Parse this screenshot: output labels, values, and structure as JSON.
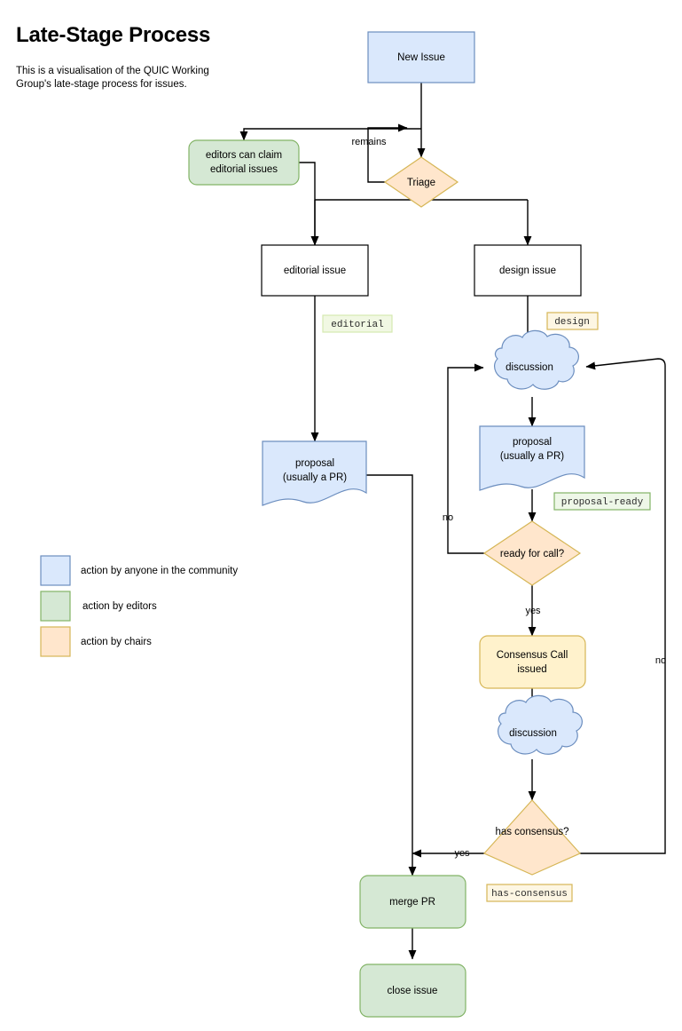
{
  "header": {
    "title": "Late-Stage Process",
    "description": "This is a visualisation of the QUIC Working Group's late-stage process for issues."
  },
  "colors": {
    "community_fill": "#dae8fc",
    "community_stroke": "#6c8ebf",
    "editors_fill": "#d5e8d4",
    "editors_stroke": "#82b366",
    "chairs_fill": "#ffe6cc",
    "chairs_stroke": "#d6b656",
    "chairs_fill_light": "#fff2cc",
    "plain_fill": "#ffffff",
    "plain_stroke": "#000000",
    "edge_stroke": "#000000",
    "tag_editorial_fill": "#f1f8e3",
    "tag_editorial_stroke": "#d6e9b0",
    "tag_design_fill": "#fdf6e3",
    "tag_design_stroke": "#d6b656",
    "tag_ready_fill": "#eef7e8",
    "tag_ready_stroke": "#82b366",
    "tag_consensus_fill": "#fdf6e3",
    "tag_consensus_stroke": "#d6b656"
  },
  "nodes": {
    "new_issue": {
      "label": "New Issue",
      "actor": "community"
    },
    "editors_claim": {
      "label_line1": "editors can claim",
      "label_line2": "editorial issues",
      "actor": "editors"
    },
    "triage": {
      "label": "Triage",
      "actor": "chairs"
    },
    "editorial_issue": {
      "label": "editorial issue",
      "actor": "plain"
    },
    "design_issue": {
      "label": "design issue",
      "actor": "plain"
    },
    "discussion_top": {
      "label": "discussion",
      "actor": "community"
    },
    "proposal_right": {
      "label_line1": "proposal",
      "label_line2": "(usually a PR)",
      "actor": "community"
    },
    "proposal_left": {
      "label_line1": "proposal",
      "label_line2": "(usually a PR)",
      "actor": "community"
    },
    "ready_for_call": {
      "label": "ready for call?",
      "actor": "chairs"
    },
    "consensus_call": {
      "label_line1": "Consensus Call",
      "label_line2": "issued",
      "actor": "chairs"
    },
    "discussion_bottom": {
      "label": "discussion",
      "actor": "community"
    },
    "has_consensus": {
      "label": "has consensus?",
      "actor": "chairs"
    },
    "merge_pr": {
      "label": "merge PR",
      "actor": "editors"
    },
    "close_issue": {
      "label": "close issue",
      "actor": "editors"
    }
  },
  "tags": [
    {
      "id": "editorial",
      "text": "editorial"
    },
    {
      "id": "design",
      "text": "design"
    },
    {
      "id": "proposal-ready",
      "text": "proposal-ready"
    },
    {
      "id": "has-consensus",
      "text": "has-consensus"
    }
  ],
  "edge_labels": {
    "remains": "remains",
    "no_ready": "no",
    "yes_ready": "yes",
    "no_consensus": "no",
    "yes_consensus": "yes"
  },
  "legend": {
    "items": [
      {
        "swatch": "community",
        "label": "action by anyone in the community"
      },
      {
        "swatch": "editors",
        "label": "action by editors"
      },
      {
        "swatch": "chairs",
        "label": "action by chairs"
      }
    ]
  }
}
